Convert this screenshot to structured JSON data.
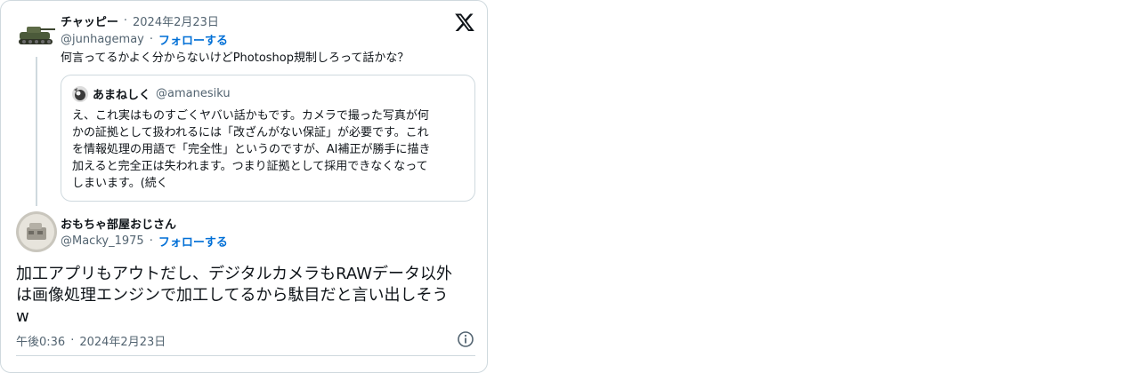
{
  "tweet_reply": {
    "name": "チャッピー",
    "date": "2024年2月23日",
    "handle": "@junhagemay",
    "follow_label": "フォローする",
    "text": "何言ってるかよく分からないけどPhotoshop規制しろって話かな？"
  },
  "quoted_tweet": {
    "name": "あまねしく",
    "handle": "@amanesiku",
    "lines": [
      "え、これ実はものすごくヤバい話かもです。カメラで撮った写真が何",
      "かの証拠として扱われるには「改ざんがない保証」が必要です。これ",
      "を情報処理の用語で「完全性」というのですが、AI補正が勝手に描き",
      "加えると完全正は失われます。つまり証拠として採用できなくなって",
      "しまいます。(続く"
    ]
  },
  "main_tweet": {
    "name": "おもちゃ部屋おじさん",
    "handle": "@Macky_1975",
    "follow_label": "フォローする",
    "lines": [
      "加工アプリもアウトだし、デジタルカメラもRAWデータ以外",
      "は画像処理エンジンで加工してるから駄目だと言い出しそう",
      "w"
    ],
    "time": "午後0:36",
    "date": "2024年2月23日"
  },
  "icons": {
    "logo": "x-logo-icon",
    "info": "info-icon"
  },
  "colors": {
    "link": "#006fd6",
    "muted": "#536471",
    "border": "#cfd9de"
  }
}
